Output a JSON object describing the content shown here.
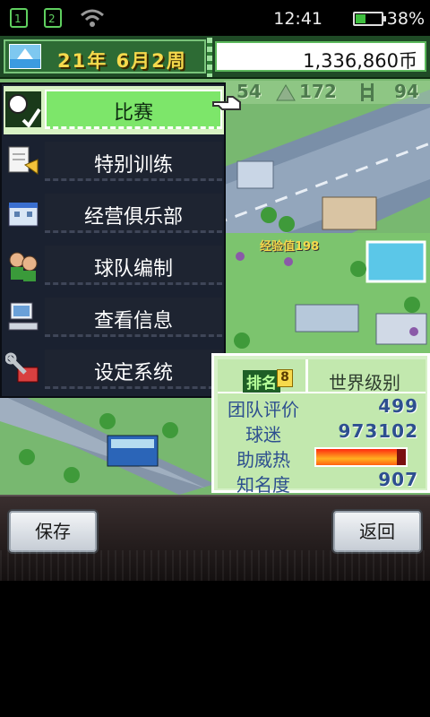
{
  "status_bar": {
    "time": "12:41",
    "battery_percent": "38%",
    "battery_level": 0.38
  },
  "topbar": {
    "date": "21年 6月2周",
    "money": "1,336,860币"
  },
  "stats_row": {
    "a": "54",
    "b": "172",
    "c": "94"
  },
  "menu": {
    "items": [
      {
        "label": "比赛",
        "icon": "match-icon",
        "active": true
      },
      {
        "label": "特别训练",
        "icon": "training-icon",
        "active": false
      },
      {
        "label": "经营俱乐部",
        "icon": "club-icon",
        "active": false
      },
      {
        "label": "球队编制",
        "icon": "team-icon",
        "active": false
      },
      {
        "label": "查看信息",
        "icon": "computer-icon",
        "active": false
      },
      {
        "label": "设定系统",
        "icon": "tools-icon",
        "active": false
      }
    ]
  },
  "panel": {
    "rank_label": "排名",
    "rank_badge": "8",
    "rank_value": "世界级别",
    "team_rating_label": "团队评价",
    "team_rating": "499",
    "fans_label": "球迷",
    "fans": "973102",
    "cheer_label": "助威热",
    "cheer_level": 0.9,
    "fame_label": "知名度",
    "fame": "907"
  },
  "buttons": {
    "save": "保存",
    "back": "返回"
  },
  "city_label": "经验值198",
  "colors": {
    "accent_green": "#7de66a",
    "hype": "#ff2a10",
    "gold": "#f6d94c"
  }
}
